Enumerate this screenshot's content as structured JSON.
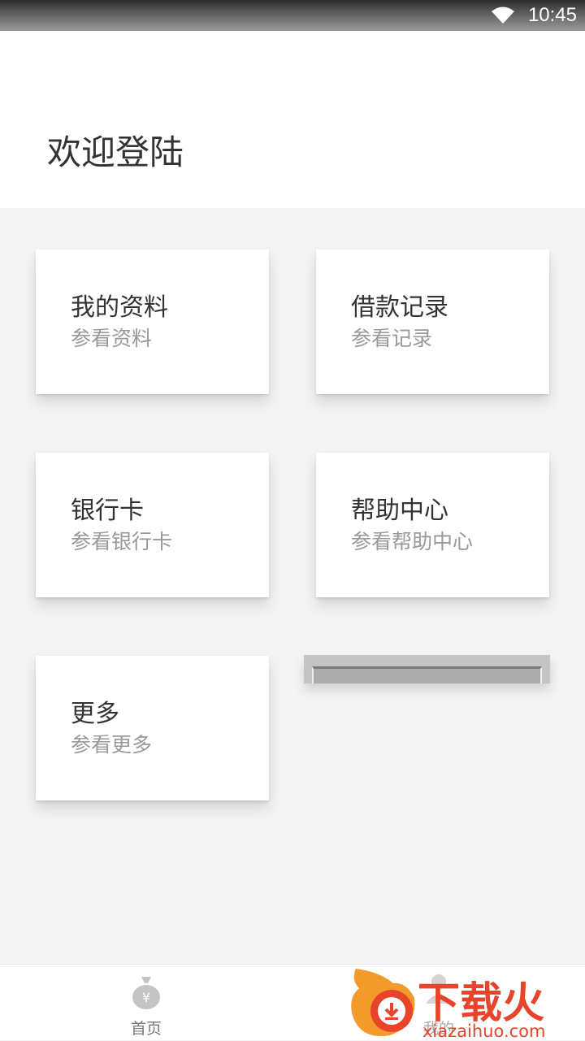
{
  "status_bar": {
    "time": "10:45",
    "icons": [
      "wifi-icon"
    ]
  },
  "header": {
    "title": "欢迎登陆"
  },
  "cards": [
    {
      "title": "我的资料",
      "subtitle": "参看资料"
    },
    {
      "title": "借款记录",
      "subtitle": "参看记录"
    },
    {
      "title": "银行卡",
      "subtitle": "参看银行卡"
    },
    {
      "title": "帮助中心",
      "subtitle": "参看帮助中心"
    },
    {
      "title": "更多",
      "subtitle": "参看更多"
    }
  ],
  "bottom_nav": {
    "items": [
      {
        "label": "首页",
        "icon": "moneybag-icon"
      },
      {
        "label": "我的",
        "icon": "person-icon"
      }
    ]
  },
  "watermark": {
    "text": "下载火",
    "url_text": "xiazaihuo.com"
  },
  "colors": {
    "watermark_red": "#e8442b",
    "watermark_orange": "#f39a2b",
    "card_bg": "#ffffff",
    "page_bg": "#f4f4f4"
  }
}
